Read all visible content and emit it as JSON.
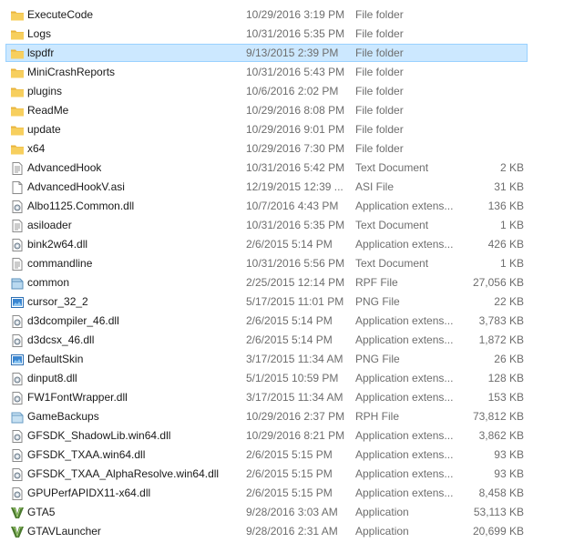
{
  "files": [
    {
      "name": "ExecuteCode",
      "date": "10/29/2016 3:19 PM",
      "type": "File folder",
      "size": "",
      "icon": "folder-icon"
    },
    {
      "name": "Logs",
      "date": "10/31/2016 5:35 PM",
      "type": "File folder",
      "size": "",
      "icon": "folder-icon"
    },
    {
      "name": "lspdfr",
      "date": "9/13/2015 2:39 PM",
      "type": "File folder",
      "size": "",
      "icon": "folder-icon",
      "selected": true
    },
    {
      "name": "MiniCrashReports",
      "date": "10/31/2016 5:43 PM",
      "type": "File folder",
      "size": "",
      "icon": "folder-icon"
    },
    {
      "name": "plugins",
      "date": "10/6/2016 2:02 PM",
      "type": "File folder",
      "size": "",
      "icon": "folder-icon"
    },
    {
      "name": "ReadMe",
      "date": "10/29/2016 8:08 PM",
      "type": "File folder",
      "size": "",
      "icon": "folder-icon"
    },
    {
      "name": "update",
      "date": "10/29/2016 9:01 PM",
      "type": "File folder",
      "size": "",
      "icon": "folder-icon"
    },
    {
      "name": "x64",
      "date": "10/29/2016 7:30 PM",
      "type": "File folder",
      "size": "",
      "icon": "folder-icon"
    },
    {
      "name": "AdvancedHook",
      "date": "10/31/2016 5:42 PM",
      "type": "Text Document",
      "size": "2 KB",
      "icon": "text-document-icon"
    },
    {
      "name": "AdvancedHookV.asi",
      "date": "12/19/2015 12:39 ...",
      "type": "ASI File",
      "size": "31 KB",
      "icon": "blank-file-icon"
    },
    {
      "name": "Albo1125.Common.dll",
      "date": "10/7/2016 4:43 PM",
      "type": "Application extens...",
      "size": "136 KB",
      "icon": "dll-file-icon"
    },
    {
      "name": "asiloader",
      "date": "10/31/2016 5:35 PM",
      "type": "Text Document",
      "size": "1 KB",
      "icon": "text-document-icon"
    },
    {
      "name": "bink2w64.dll",
      "date": "2/6/2015 5:14 PM",
      "type": "Application extens...",
      "size": "426 KB",
      "icon": "dll-file-icon"
    },
    {
      "name": "commandline",
      "date": "10/31/2016 5:56 PM",
      "type": "Text Document",
      "size": "1 KB",
      "icon": "text-document-icon"
    },
    {
      "name": "common",
      "date": "2/25/2015 12:14 PM",
      "type": "RPF File",
      "size": "27,056 KB",
      "icon": "rpf-file-icon"
    },
    {
      "name": "cursor_32_2",
      "date": "5/17/2015 11:01 PM",
      "type": "PNG File",
      "size": "22 KB",
      "icon": "png-image-icon"
    },
    {
      "name": "d3dcompiler_46.dll",
      "date": "2/6/2015 5:14 PM",
      "type": "Application extens...",
      "size": "3,783 KB",
      "icon": "dll-file-icon"
    },
    {
      "name": "d3dcsx_46.dll",
      "date": "2/6/2015 5:14 PM",
      "type": "Application extens...",
      "size": "1,872 KB",
      "icon": "dll-file-icon"
    },
    {
      "name": "DefaultSkin",
      "date": "3/17/2015 11:34 AM",
      "type": "PNG File",
      "size": "26 KB",
      "icon": "png-image-icon"
    },
    {
      "name": "dinput8.dll",
      "date": "5/1/2015 10:59 PM",
      "type": "Application extens...",
      "size": "128 KB",
      "icon": "dll-file-icon"
    },
    {
      "name": "FW1FontWrapper.dll",
      "date": "3/17/2015 11:34 AM",
      "type": "Application extens...",
      "size": "153 KB",
      "icon": "dll-file-icon"
    },
    {
      "name": "GameBackups",
      "date": "10/29/2016 2:37 PM",
      "type": "RPH File",
      "size": "73,812 KB",
      "icon": "rph-file-icon"
    },
    {
      "name": "GFSDK_ShadowLib.win64.dll",
      "date": "10/29/2016 8:21 PM",
      "type": "Application extens...",
      "size": "3,862 KB",
      "icon": "dll-file-icon"
    },
    {
      "name": "GFSDK_TXAA.win64.dll",
      "date": "2/6/2015 5:15 PM",
      "type": "Application extens...",
      "size": "93 KB",
      "icon": "dll-file-icon"
    },
    {
      "name": "GFSDK_TXAA_AlphaResolve.win64.dll",
      "date": "2/6/2015 5:15 PM",
      "type": "Application extens...",
      "size": "93 KB",
      "icon": "dll-file-icon"
    },
    {
      "name": "GPUPerfAPIDX11-x64.dll",
      "date": "2/6/2015 5:15 PM",
      "type": "Application extens...",
      "size": "8,458 KB",
      "icon": "dll-file-icon"
    },
    {
      "name": "GTA5",
      "date": "9/28/2016 3:03 AM",
      "type": "Application",
      "size": "53,113 KB",
      "icon": "gta-v-app-icon"
    },
    {
      "name": "GTAVLauncher",
      "date": "9/28/2016 2:31 AM",
      "type": "Application",
      "size": "20,699 KB",
      "icon": "gta-v-app-icon"
    }
  ],
  "colors": {
    "selection_bg": "#cce8ff",
    "selection_border": "#99d1ff",
    "folder": "#f3c04f",
    "secondary_text": "#6d6d6d"
  }
}
